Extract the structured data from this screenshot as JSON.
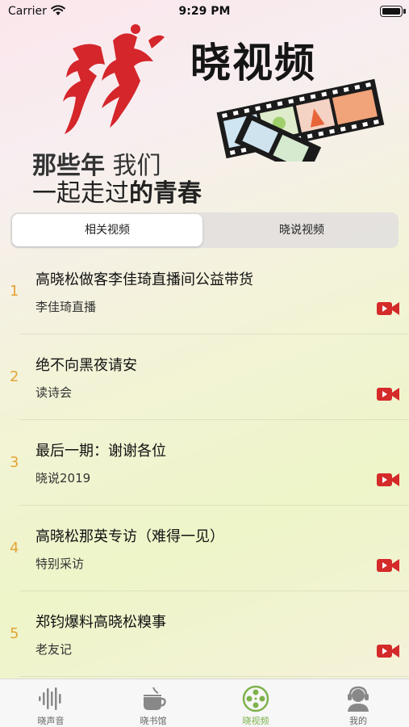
{
  "status_bar": {
    "carrier": "Carrier",
    "time": "9:29 PM"
  },
  "banner": {
    "title": "晓视频",
    "slogan_line1_bold": "那些年",
    "slogan_line1_light": " 我们",
    "slogan_line2_light": "一起走过",
    "slogan_line2_bold": "的青春"
  },
  "segments": [
    {
      "label": "相关视频",
      "selected": true
    },
    {
      "label": "晓说视频",
      "selected": false
    }
  ],
  "videos": [
    {
      "index": "1",
      "title": "高晓松做客李佳琦直播间公益带货",
      "subtitle": "李佳琦直播",
      "icon": "video-camera-icon"
    },
    {
      "index": "2",
      "title": "绝不向黑夜请安",
      "subtitle": "读诗会",
      "icon": "video-camera-icon"
    },
    {
      "index": "3",
      "title": "最后一期：谢谢各位",
      "subtitle": "晓说2019",
      "icon": "video-camera-icon"
    },
    {
      "index": "4",
      "title": "高晓松那英专访（难得一见）",
      "subtitle": "特别采访",
      "icon": "video-camera-icon"
    },
    {
      "index": "5",
      "title": "郑钧爆料高晓松糗事",
      "subtitle": "老友记",
      "icon": "video-camera-icon"
    }
  ],
  "tabbar": [
    {
      "label": "晓声音",
      "icon": "soundwave-icon",
      "active": false
    },
    {
      "label": "晓书馆",
      "icon": "teacup-icon",
      "active": false
    },
    {
      "label": "晓视频",
      "icon": "film-reel-icon",
      "active": true
    },
    {
      "label": "我的",
      "icon": "user-headset-icon",
      "active": false
    }
  ],
  "colors": {
    "accent_green": "#7eb24c",
    "index_orange": "#e3a437",
    "camera_red": "#d42a2a",
    "brush_red": "#d4262b"
  }
}
